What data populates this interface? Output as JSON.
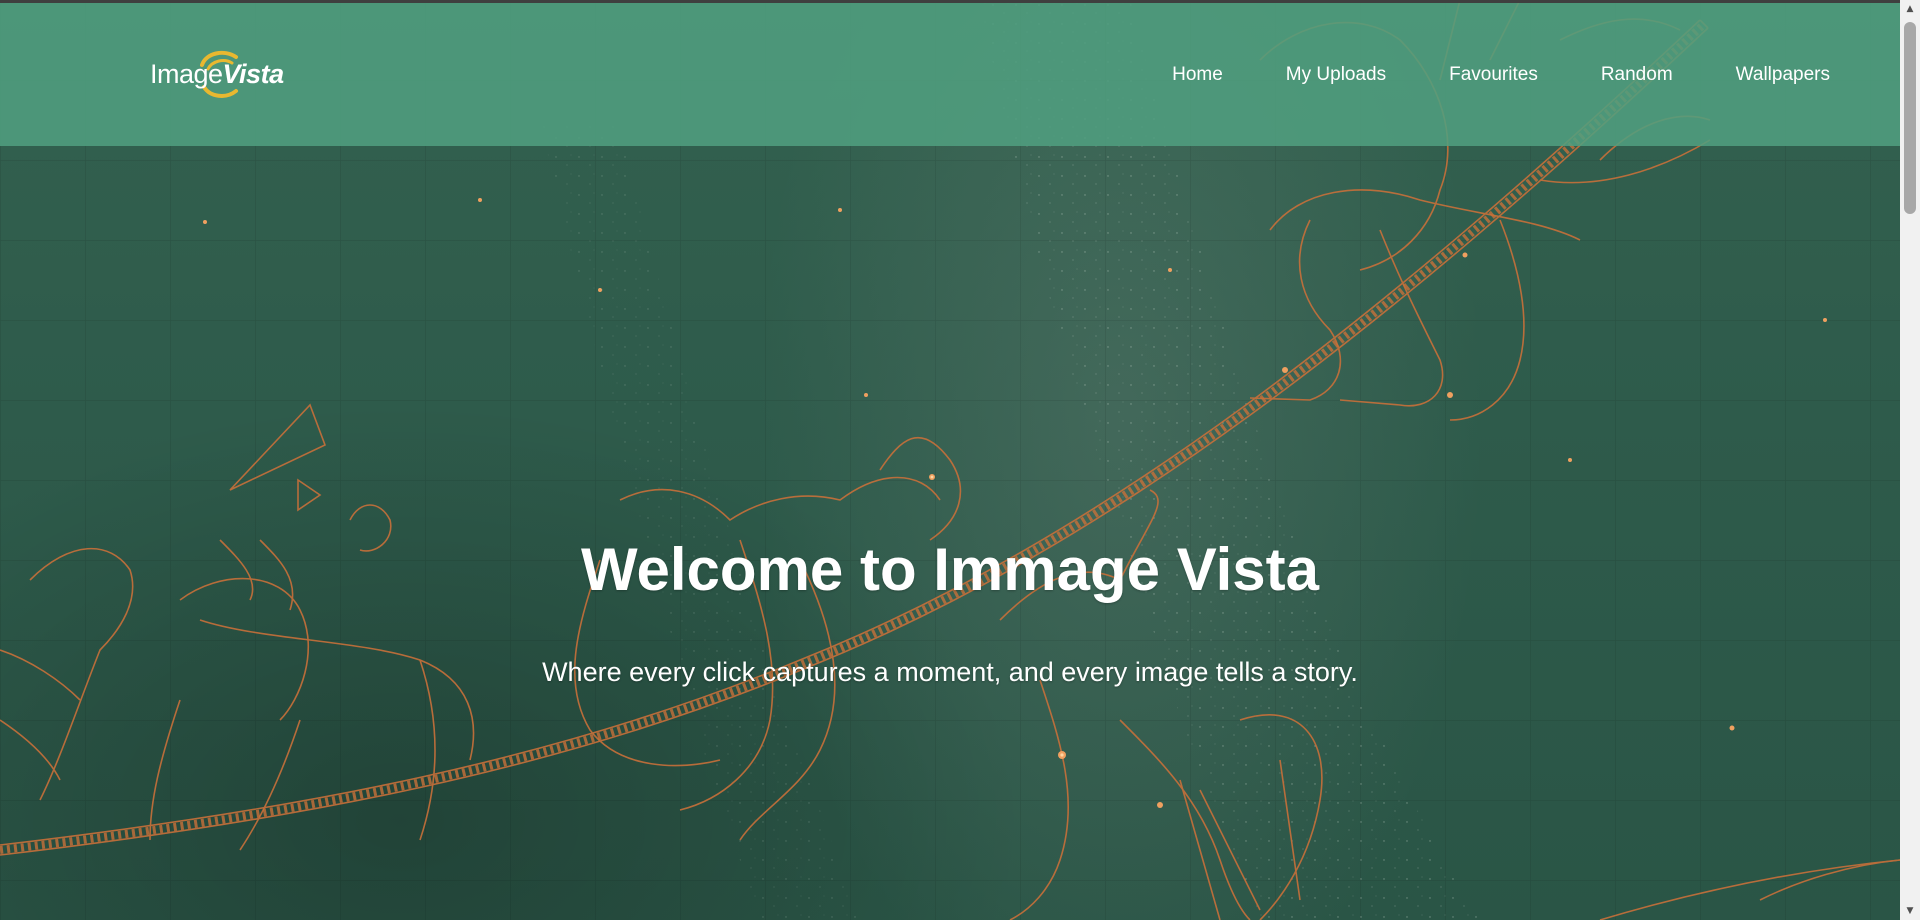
{
  "logo": {
    "word1": "Image",
    "word2": "Vista"
  },
  "nav": {
    "items": [
      {
        "label": "Home"
      },
      {
        "label": "My Uploads"
      },
      {
        "label": "Favourites"
      },
      {
        "label": "Random"
      },
      {
        "label": "Wallpapers"
      }
    ]
  },
  "hero": {
    "title": "Welcome to Immage Vista",
    "subtitle": "Where every click captures a moment, and every image tells a story."
  },
  "scrollbar": {
    "up_glyph": "▲",
    "down_glyph": "▼"
  },
  "colors": {
    "navbar": "#50a080",
    "background": "#2d5a4b",
    "constellation_lines": "#c8703a",
    "logo_accent": "#e8b830",
    "text": "#ffffff"
  }
}
